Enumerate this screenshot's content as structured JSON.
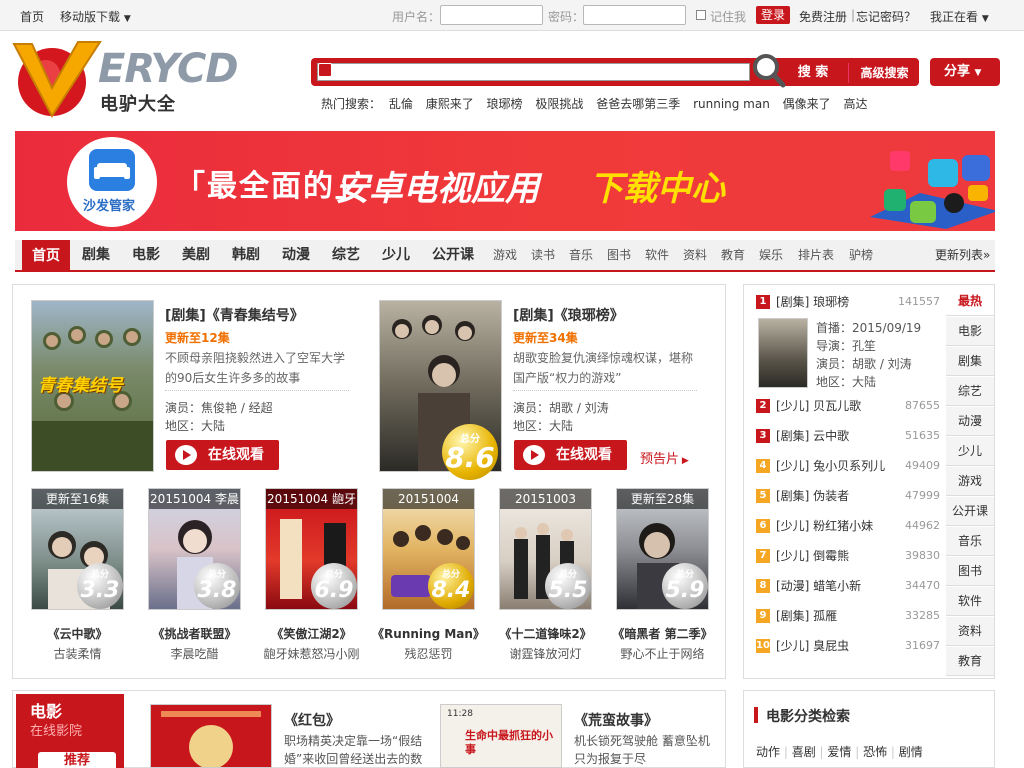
{
  "topbar": {
    "home": "首页",
    "mobile_download": "移动版下载",
    "username_label": "用户名：",
    "password_label": "密码：",
    "remember_label": "记住我",
    "login_label": "登录",
    "register_label": "免费注册",
    "forgot_label": "忘记密码？",
    "watching_label": "我正在看"
  },
  "header": {
    "logo_text": "ERYCD",
    "logo_subtitle": "电驴大全",
    "search_button": "搜 索",
    "advanced_search": "高级搜索",
    "share": "分享",
    "hot_label": "热门搜索：",
    "hot_terms": [
      "乱倫",
      "康熙来了",
      "琅琊榜",
      "极限挑战",
      "爸爸去哪第三季",
      "running man",
      "偶像来了",
      "高达"
    ]
  },
  "banner": {
    "app_name": "沙发管家",
    "text_1": "「最全面的」",
    "text_2": "安卓电视应用",
    "text_3": "下载中心"
  },
  "nav": {
    "home": "首页",
    "main_items": [
      "剧集",
      "电影",
      "美剧",
      "韩剧",
      "动漫",
      "综艺",
      "少儿",
      "公开课"
    ],
    "sub_items": [
      "游戏",
      "读书",
      "音乐",
      "图书",
      "软件",
      "资料",
      "教育",
      "娱乐",
      "排片表",
      "驴榜"
    ],
    "more": "更新列表»"
  },
  "features": [
    {
      "title": "[剧集]《青春集结号》",
      "update": "更新至12集",
      "desc": "不顾母亲阻挠毅然进入了空军大学的90后女生许多多的故事",
      "actors": "演员：焦俊艳 / 经超",
      "region": "地区：大陆",
      "watch": "在线观看",
      "poster_text": "青春集结号"
    },
    {
      "title": "[剧集]《琅琊榜》",
      "update": "更新至34集",
      "desc": "胡歌变脸复仇演绎惊魂权谋，堪称国产版“权力的游戏”",
      "actors": "演员：胡歌 / 刘涛",
      "region": "地区：大陆",
      "watch": "在线观看",
      "trailer": "预告片",
      "score_label": "总分",
      "score": "8.6"
    }
  ],
  "small_posters": [
    {
      "caption": "更新至16集",
      "score_label": "总分",
      "score": "3.3",
      "title": "《云中歌》",
      "sub": "古装柔情"
    },
    {
      "caption": "20151004 李晨",
      "score_label": "总分",
      "score": "3.8",
      "title": "《挑战者联盟》",
      "sub": "李晨吃醋"
    },
    {
      "caption": "20151004 龅牙",
      "score_label": "总分",
      "score": "6.9",
      "title": "《笑傲江湖2》",
      "sub": "龅牙妹惹怒冯小刚"
    },
    {
      "caption": "20151004",
      "score_label": "总分",
      "score": "8.4",
      "title": "《Running Man》",
      "sub": "残忍惩罚"
    },
    {
      "caption": "20151003",
      "score_label": "总分",
      "score": "5.5",
      "title": "《十二道锋味2》",
      "sub": "谢霆锋放河灯"
    },
    {
      "caption": "更新至28集",
      "score_label": "总分",
      "score": "5.9",
      "title": "《暗黑者 第二季》",
      "sub": "野心不止于网络"
    }
  ],
  "ranking": {
    "top": {
      "rank": "1",
      "name": "[剧集] 琅琊榜",
      "count": "141557",
      "premiere": "首播：2015/09/19",
      "director": "导演：孔笙",
      "actors": "演员：胡歌 / 刘涛",
      "region": "地区：大陆"
    },
    "rows": [
      {
        "rank": "2",
        "name": "[少儿] 贝瓦儿歌",
        "count": "87655"
      },
      {
        "rank": "3",
        "name": "[剧集] 云中歌",
        "count": "51635"
      },
      {
        "rank": "4",
        "name": "[少儿] 兔小贝系列儿",
        "count": "49409"
      },
      {
        "rank": "5",
        "name": "[剧集] 伪装者",
        "count": "47999"
      },
      {
        "rank": "6",
        "name": "[少儿] 粉红猪小妹",
        "count": "44962"
      },
      {
        "rank": "7",
        "name": "[少儿] 倒霉熊",
        "count": "39830"
      },
      {
        "rank": "8",
        "name": "[动漫] 蜡笔小新",
        "count": "34470"
      },
      {
        "rank": "9",
        "name": "[剧集] 孤雁",
        "count": "33285"
      },
      {
        "rank": "10",
        "name": "[少儿] 臭屁虫",
        "count": "31697"
      }
    ],
    "tabs": [
      "最热",
      "电影",
      "剧集",
      "综艺",
      "动漫",
      "少儿",
      "游戏",
      "公开课",
      "音乐",
      "图书",
      "软件",
      "资料",
      "教育"
    ]
  },
  "movies": {
    "section_title": "电影",
    "section_sub": "在线影院",
    "recommend": "推荐",
    "items": [
      {
        "title": "《红包》",
        "desc": "职场精英决定靠一场“假结婚”来收回曾经送出去的数"
      },
      {
        "title": "《荒蛮故事》",
        "desc": "机长锁死驾驶舱 蓄意坠机 只为报复于尽",
        "poster_top": "11:28",
        "poster_title": "生命中最抓狂的小事"
      }
    ]
  },
  "categories": {
    "title": "电影分类检索",
    "items": [
      "动作",
      "喜剧",
      "爱情",
      "恐怖",
      "剧情"
    ]
  },
  "colors": {
    "brand_red": "#c8161d",
    "update_orange": "#f07000"
  }
}
